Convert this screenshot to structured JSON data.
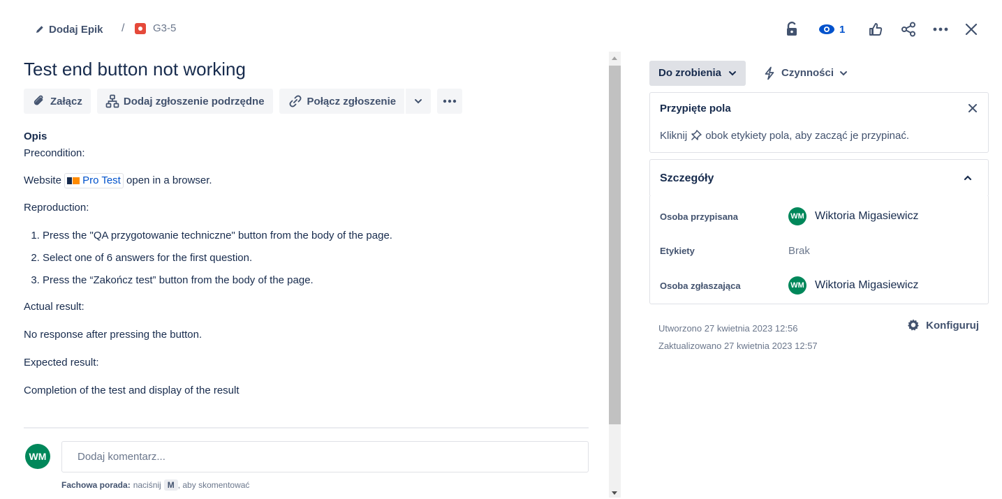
{
  "breadcrumb": {
    "epic_label": "Dodaj Epik",
    "separator": "/",
    "issue_key": "G3-5"
  },
  "header": {
    "watch_count": "1"
  },
  "issue": {
    "title": "Test end button not working"
  },
  "toolbar": {
    "attach_label": "Załącz",
    "child_label": "Dodaj zgłoszenie podrzędne",
    "link_label": "Połącz zgłoszenie"
  },
  "description": {
    "label": "Opis",
    "precondition": "Precondition:",
    "website_before": "Website",
    "website_link": "Pro Test",
    "website_after": "open in a browser.",
    "reproduction": "Reproduction:",
    "steps": [
      "Press the \"QA przygotowanie techniczne\" button from the body of the page.",
      "Select one of 6 answers for the first question.",
      "Press the “Zakończ test” button from the body of the page."
    ],
    "actual_label": "Actual result:",
    "actual_text": "No response after pressing the button.",
    "expected_label": "Expected result:",
    "expected_text": "Completion of the test and display of the result"
  },
  "comment": {
    "avatar_initials": "WM",
    "placeholder": "Dodaj komentarz...",
    "tip_bold": "Fachowa porada:",
    "tip_before": "naciśnij",
    "tip_key": "M",
    "tip_after": ", aby skomentować"
  },
  "status": {
    "current": "Do zrobienia",
    "actions_label": "Czynności"
  },
  "pinned": {
    "title": "Przypięte pola",
    "msg_before": "Kliknij",
    "msg_after": "obok etykiety pola, aby zacząć je przypinać."
  },
  "details": {
    "title": "Szczegóły",
    "assignee_label": "Osoba przypisana",
    "assignee_initials": "WM",
    "assignee_name": "Wiktoria Migasiewicz",
    "labels_label": "Etykiety",
    "labels_value": "Brak",
    "reporter_label": "Osoba zgłaszająca",
    "reporter_initials": "WM",
    "reporter_name": "Wiktoria Migasiewicz"
  },
  "meta": {
    "created": "Utworzono 27 kwietnia 2023 12:56",
    "updated": "Zaktualizowano 27 kwietnia 2023 12:57",
    "configure_label": "Konfiguruj"
  },
  "colors": {
    "accent": "#0052cc",
    "avatar": "#00875a",
    "bug": "#e5493a",
    "text": "#172b4d"
  }
}
